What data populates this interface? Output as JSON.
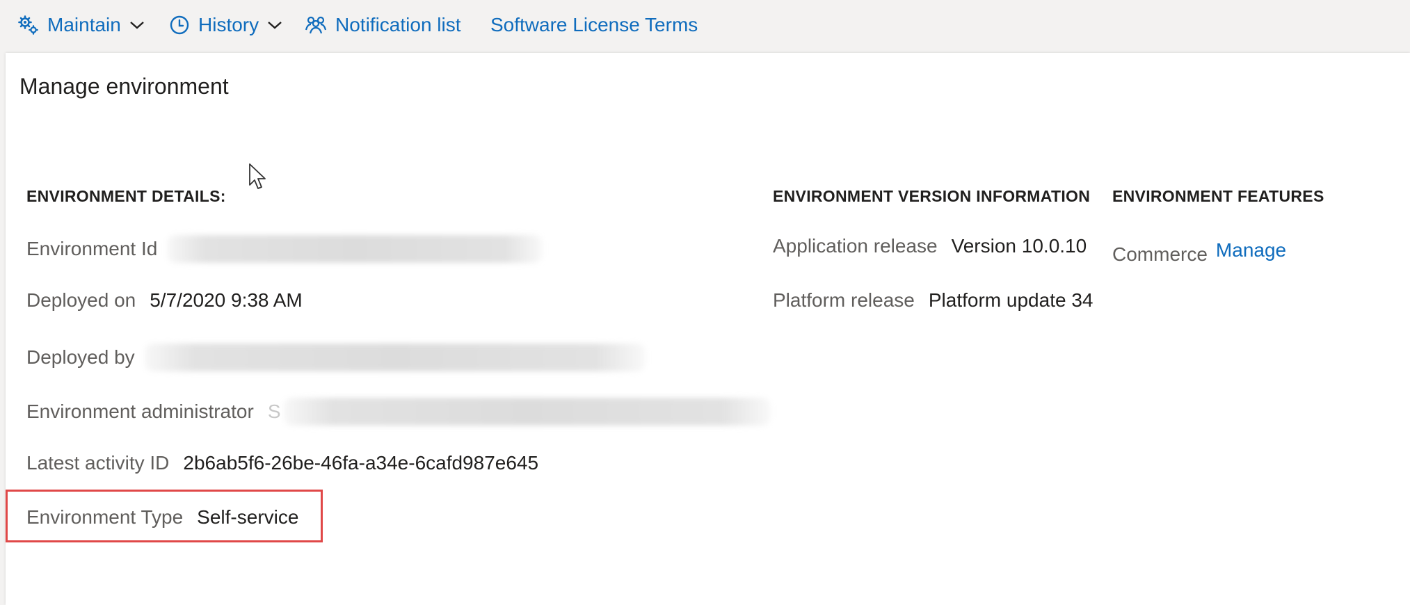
{
  "toolbar": {
    "maintain_label": "Maintain",
    "history_label": "History",
    "notification_label": "Notification list",
    "license_label": "Software License Terms",
    "icons": {
      "maintain": "gears-icon",
      "history": "clock-icon",
      "notification": "people-group-icon",
      "chevron": "chevron-down-icon"
    }
  },
  "page": {
    "title": "Manage environment"
  },
  "details": {
    "heading": "ENVIRONMENT DETAILS:",
    "env_id_label": "Environment Id",
    "deployed_on_label": "Deployed on",
    "deployed_on_value": "5/7/2020 9:38 AM",
    "deployed_by_label": "Deployed by",
    "admin_label": "Environment administrator",
    "admin_value_prefix": "S",
    "activity_label": "Latest activity ID",
    "activity_value": "2b6ab5f6-26be-46fa-a34e-6cafd987e645",
    "type_label": "Environment Type",
    "type_value": "Self-service"
  },
  "version": {
    "heading": "ENVIRONMENT VERSION INFORMATION",
    "app_release_label": "Application release",
    "app_release_value": "Version 10.0.10",
    "platform_release_label": "Platform release",
    "platform_release_value": "Platform update 34"
  },
  "features": {
    "heading": "ENVIRONMENT FEATURES",
    "commerce_label": "Commerce",
    "manage_link": "Manage"
  },
  "colors": {
    "accent": "#0f6cbd",
    "highlight": "#e04848",
    "label": "#605e5c",
    "text": "#201f1e",
    "background": "#f3f2f1"
  }
}
